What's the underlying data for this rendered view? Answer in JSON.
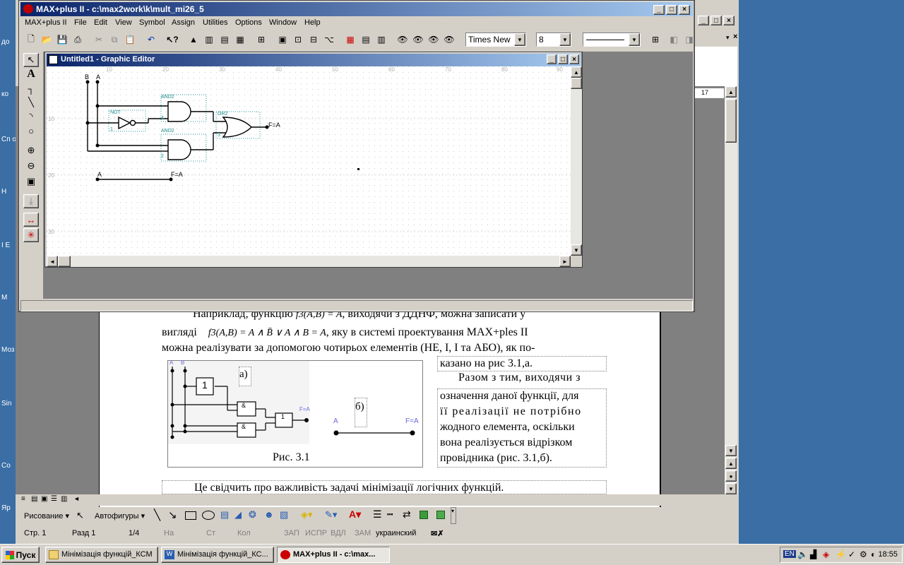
{
  "desktop": {
    "icon_labels": [
      "до",
      "ко",
      "Сп ок",
      "Н",
      "I Е",
      "М",
      "Моз",
      "Sin",
      "Со",
      "Яр"
    ]
  },
  "word": {
    "ruler_mark": "17",
    "doc_lines": {
      "line1": "Наприклад, функцію",
      "line1_formula": "f3(A,B) = A",
      "line1_rest": ", виходячи з ДДНФ, можна записати у",
      "line2_start": "вигляді",
      "line2_formula": "f3(A,B) = A ∧ B̄ ∨ A ∧ B = A",
      "line2_rest": ", яку в системі проектування MAX+ples II",
      "line3": "можна реалізувати за допомогою чотирьох елементів (НЕ, І, І та АБО), як по-",
      "line4": "казано на рис 3.1,а.",
      "line5": "Разом з тим, виходячи з",
      "line6": "означення даної функції, для",
      "line7": "її реалізації не потрібно",
      "line8": "жодного елемента, оскільки",
      "line9": "вона реалізується відрізком",
      "line10": "провідника (рис. 3.1,б).",
      "line11": "Це свідчить про важливість задачі мінімізації логічних функцій."
    },
    "figure": {
      "caption": "Рис. 3.1",
      "label_a": "а)",
      "label_b": "б)",
      "pin_a": "A",
      "pin_b": "B",
      "not_label": "1",
      "and_label": "&",
      "or_label": "1",
      "out_label": "F=A",
      "wire_a": "A",
      "wire_out": "F=A"
    },
    "draw_toolbar": {
      "draw_menu": "Рисование",
      "autoshapes": "Автофигуры"
    },
    "status": {
      "page": "Стр. 1",
      "section": "Разд 1",
      "pages": "1/4",
      "at": "На",
      "line": "Ст",
      "col": "Кол",
      "rec": "ЗАП",
      "trk": "ИСПР",
      "ext": "ВДЛ",
      "ovr": "ЗАМ",
      "lang": "украинский"
    }
  },
  "max": {
    "title": "MAX+plus II - c:\\max2work\\k\\mult_mi26_5",
    "menu": [
      "MAX+plus II",
      "File",
      "Edit",
      "View",
      "Symbol",
      "Assign",
      "Utilities",
      "Options",
      "Window",
      "Help"
    ],
    "font_name": "Times New",
    "font_size": "8",
    "editor": {
      "title": "Untitled1 - Graphic Editor",
      "ruler_x": [
        "10",
        "20",
        "30",
        "40",
        "50",
        "60",
        "70",
        "80",
        "90"
      ],
      "ruler_y": [
        "10",
        "20",
        "30"
      ],
      "pin_b": "B",
      "pin_a": "A",
      "not_name": "NOT",
      "not_num": "1",
      "and_top_name": "AND2",
      "and_top_num": "4",
      "and_bot_name": "AND2",
      "and_bot_num": "2",
      "or_name": "OR2",
      "or_num": "3",
      "output": "F=A",
      "wire_in": "A",
      "wire_out": "F=A"
    }
  },
  "taskbar": {
    "start": "Пуск",
    "tasks": [
      "Мінімізація функцій_КСМ",
      "Мінімізація функцій_КС...",
      "MAX+plus II - c:\\max..."
    ],
    "lang": "EN",
    "clock": "18:55"
  }
}
